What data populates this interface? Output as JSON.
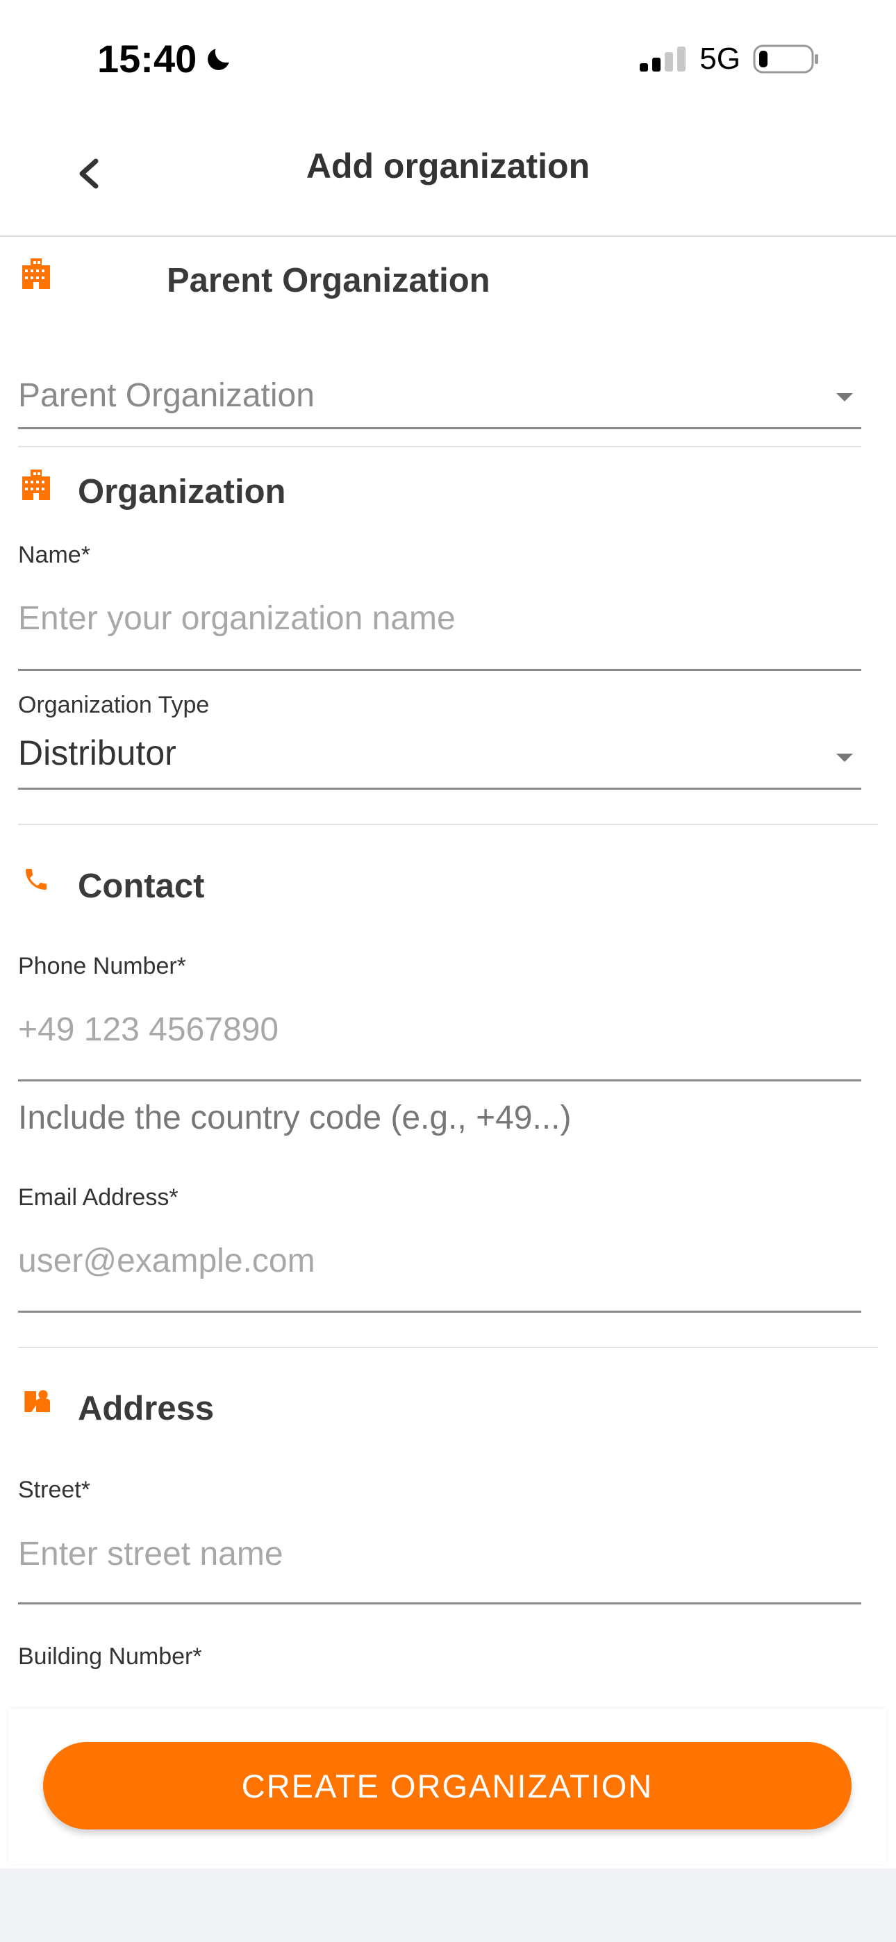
{
  "status_bar": {
    "time": "15:40",
    "network": "5G"
  },
  "header": {
    "title": "Add organization"
  },
  "parent_section": {
    "title": "Parent Organization",
    "select_placeholder": "Parent Organization"
  },
  "organization_section": {
    "title": "Organization",
    "name_label": "Name*",
    "name_placeholder": "Enter your organization name",
    "type_label": "Organization Type",
    "type_value": "Distributor"
  },
  "contact_section": {
    "title": "Contact",
    "phone_label": "Phone Number*",
    "phone_placeholder": "+49 123 4567890",
    "phone_helper": "Include the country code (e.g., +49...)",
    "email_label": "Email Address*",
    "email_placeholder": "user@example.com"
  },
  "address_section": {
    "title": "Address",
    "street_label": "Street*",
    "street_placeholder": "Enter street name",
    "building_label": "Building Number*"
  },
  "footer": {
    "cta_label": "CREATE ORGANIZATION"
  },
  "colors": {
    "accent": "#ff7300",
    "text": "#333333",
    "placeholder": "#a8a8a8",
    "divider": "#e2e2e2"
  },
  "icons": [
    "moon-icon",
    "signal-icon",
    "battery-icon",
    "back-chevron-icon",
    "building-icon",
    "phone-icon",
    "address-icon",
    "dropdown-caret-icon"
  ]
}
